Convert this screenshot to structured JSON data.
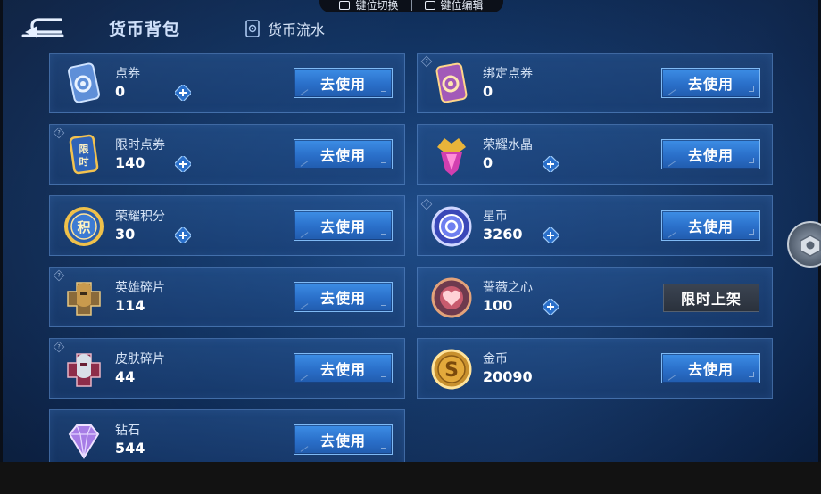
{
  "overlay": {
    "item1": "键位切换",
    "item2": "键位编辑"
  },
  "header": {
    "title": "货币背包",
    "flow_tab": "货币流水"
  },
  "cards": [
    {
      "name": "点券",
      "count": "0",
      "button": "去使用",
      "icon": "ticket-icon",
      "has_add": true,
      "has_question": false
    },
    {
      "name": "绑定点券",
      "count": "0",
      "button": "去使用",
      "icon": "bound-ticket-icon",
      "has_add": false,
      "has_question": true
    },
    {
      "name": "限时点券",
      "count": "140",
      "button": "去使用",
      "icon": "limited-ticket-icon",
      "badge_text": "限时",
      "has_add": true,
      "has_question": true
    },
    {
      "name": "荣耀水晶",
      "count": "0",
      "button": "去使用",
      "icon": "glory-crystal-icon",
      "has_add": true,
      "has_question": false
    },
    {
      "name": "荣耀积分",
      "count": "30",
      "button": "去使用",
      "icon": "glory-points-icon",
      "badge_text": "积",
      "has_add": true,
      "has_question": false
    },
    {
      "name": "星币",
      "count": "3260",
      "button": "去使用",
      "icon": "star-coin-icon",
      "has_add": true,
      "has_question": true
    },
    {
      "name": "英雄碎片",
      "count": "114",
      "button": "去使用",
      "icon": "hero-fragment-icon",
      "has_add": false,
      "has_question": true
    },
    {
      "name": "蔷薇之心",
      "count": "100",
      "button": "限时上架",
      "button_disabled": true,
      "icon": "rose-heart-icon",
      "has_add": true,
      "has_question": false
    },
    {
      "name": "皮肤碎片",
      "count": "44",
      "button": "去使用",
      "icon": "skin-fragment-icon",
      "has_add": false,
      "has_question": true
    },
    {
      "name": "金币",
      "count": "20090",
      "button": "去使用",
      "icon": "gold-coin-icon",
      "badge_text": "S",
      "has_add": false,
      "has_question": false
    },
    {
      "name": "钻石",
      "count": "544",
      "button": "去使用",
      "icon": "diamond-icon",
      "has_add": false,
      "has_question": false
    }
  ],
  "colors": {
    "accent_button": "#2a6fc9",
    "card_border": "#6ea0e1",
    "background": "#123463"
  }
}
